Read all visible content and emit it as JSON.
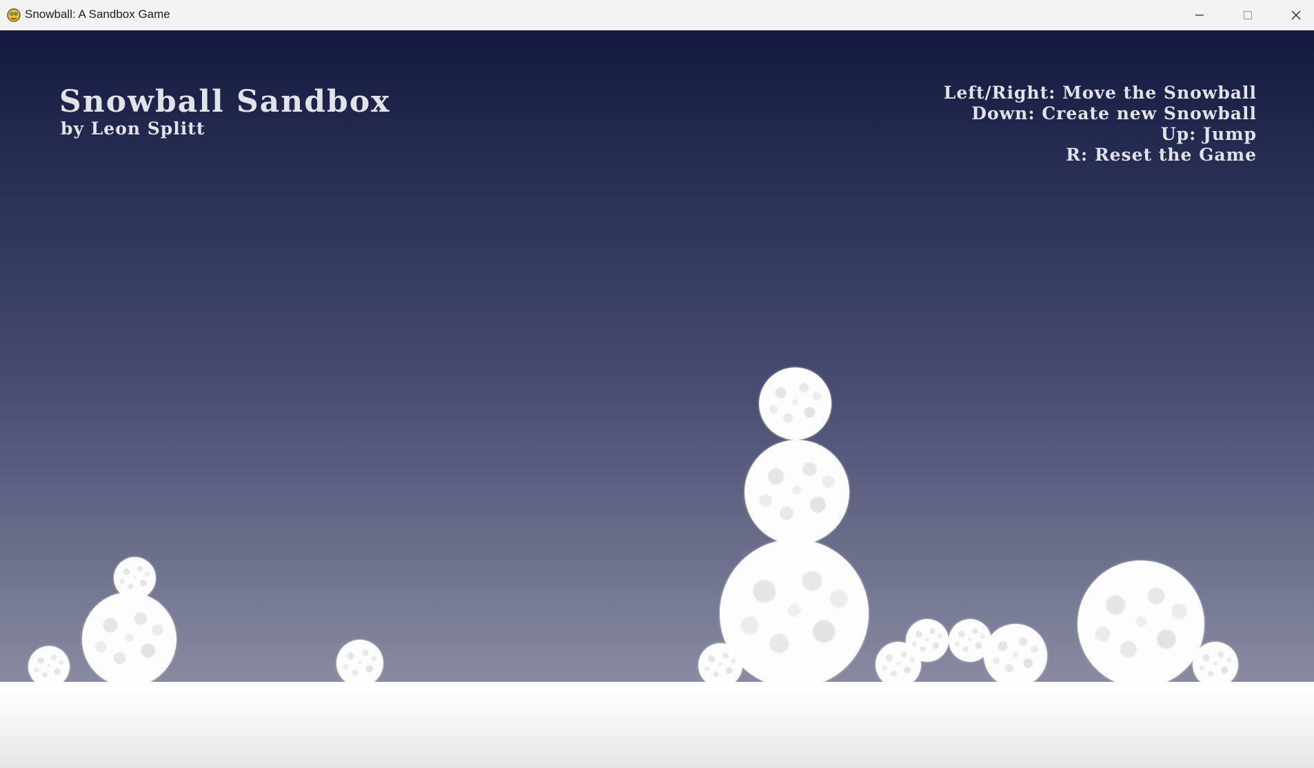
{
  "window": {
    "title": "Snowball: A Sandbox Game",
    "icon": "pygame-snake-icon",
    "controls": [
      "minimize-icon",
      "maximize-icon",
      "close-icon"
    ]
  },
  "game": {
    "title": "Snowball Sandbox",
    "author": "by Leon Splitt",
    "controls": [
      "Left/Right: Move the Snowball",
      "Down: Create new Snowball",
      "Up: Jump",
      "R: Reset the Game"
    ]
  },
  "colors": {
    "sky_top": "#141a3e",
    "sky_bottom": "#8c8fa5",
    "snow": "#ffffff",
    "hud_text": "#e2e3e8",
    "titlebar": "#f3f3f3"
  }
}
